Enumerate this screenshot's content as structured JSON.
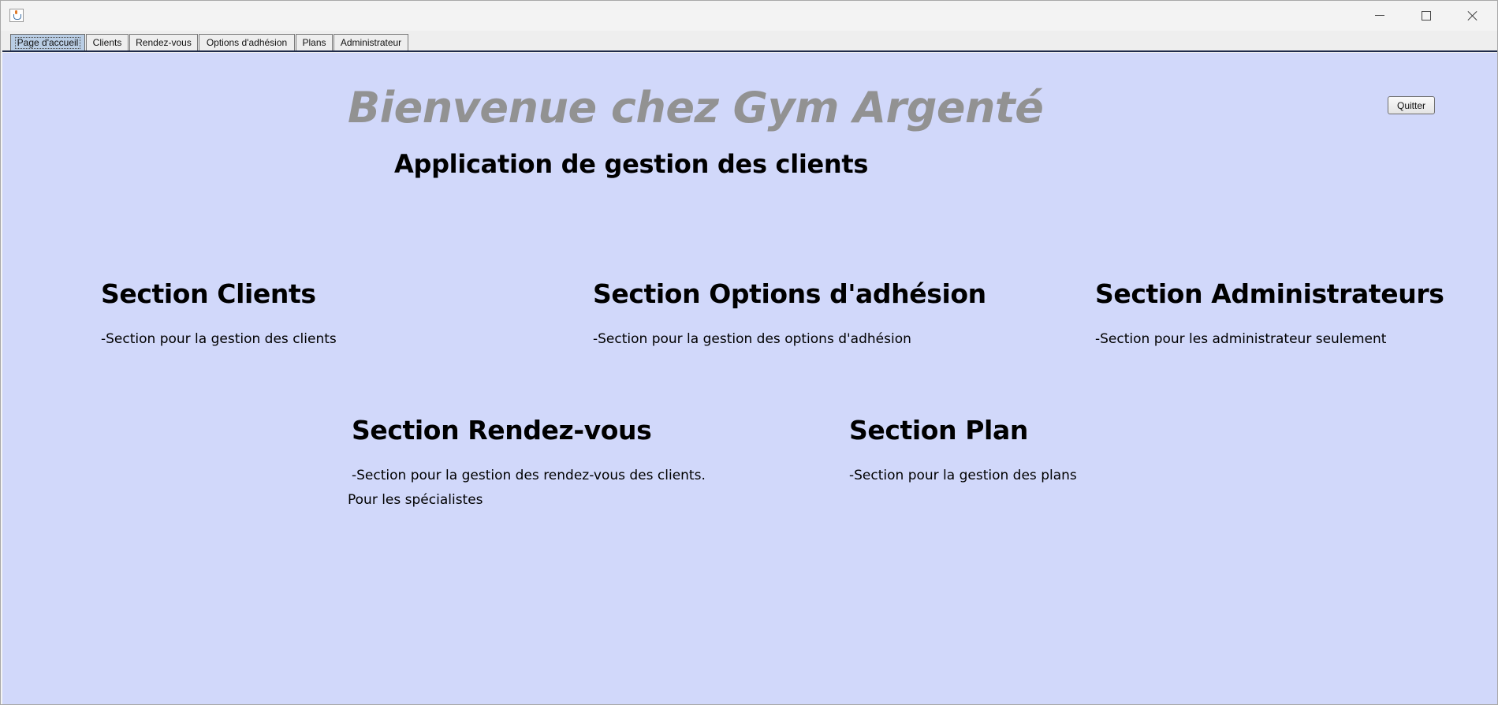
{
  "tabs": [
    {
      "label": "Page d'accueil",
      "active": true
    },
    {
      "label": "Clients"
    },
    {
      "label": "Rendez-vous"
    },
    {
      "label": "Options d'adhésion"
    },
    {
      "label": "Plans"
    },
    {
      "label": "Administrateur"
    }
  ],
  "home": {
    "welcome": "Bienvenue chez Gym Argenté",
    "subtitle": "Application de gestion des clients",
    "quit_label": "Quitter",
    "sections": {
      "clients": {
        "title": "Section Clients",
        "desc": "-Section pour la gestion des clients"
      },
      "options": {
        "title": "Section Options d'adhésion",
        "desc": "-Section pour la gestion des options d'adhésion"
      },
      "admins": {
        "title": "Section Administrateurs",
        "desc": "-Section pour les administrateur seulement"
      },
      "rdv": {
        "title": "Section Rendez-vous",
        "desc": "-Section pour la gestion des rendez-vous des clients.",
        "desc2": "Pour les spécialistes"
      },
      "plan": {
        "title": "Section Plan",
        "desc": "-Section pour la gestion des plans"
      }
    }
  },
  "colors": {
    "content_bg": "#d1d8fa",
    "welcome_text": "#929292",
    "active_tab": "#b9cde4"
  }
}
